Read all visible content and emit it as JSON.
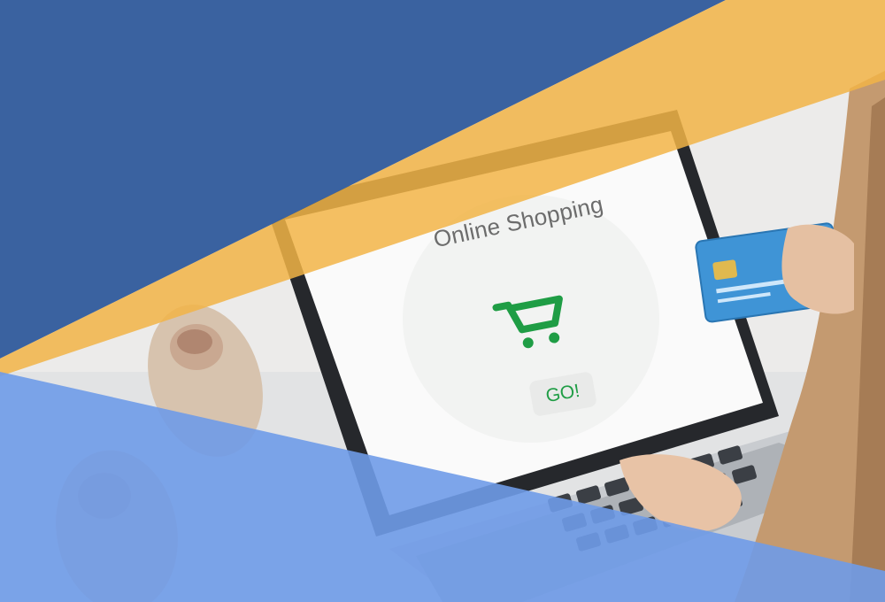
{
  "screen": {
    "title": "Online Shopping",
    "button_label": "GO!",
    "icon": "shopping-cart-icon"
  },
  "colors": {
    "banner_blue": "#3a62a0",
    "banner_yellow": "#f2b446",
    "banner_light_blue": "#6f9be8",
    "accent_green": "#1f9d45"
  }
}
